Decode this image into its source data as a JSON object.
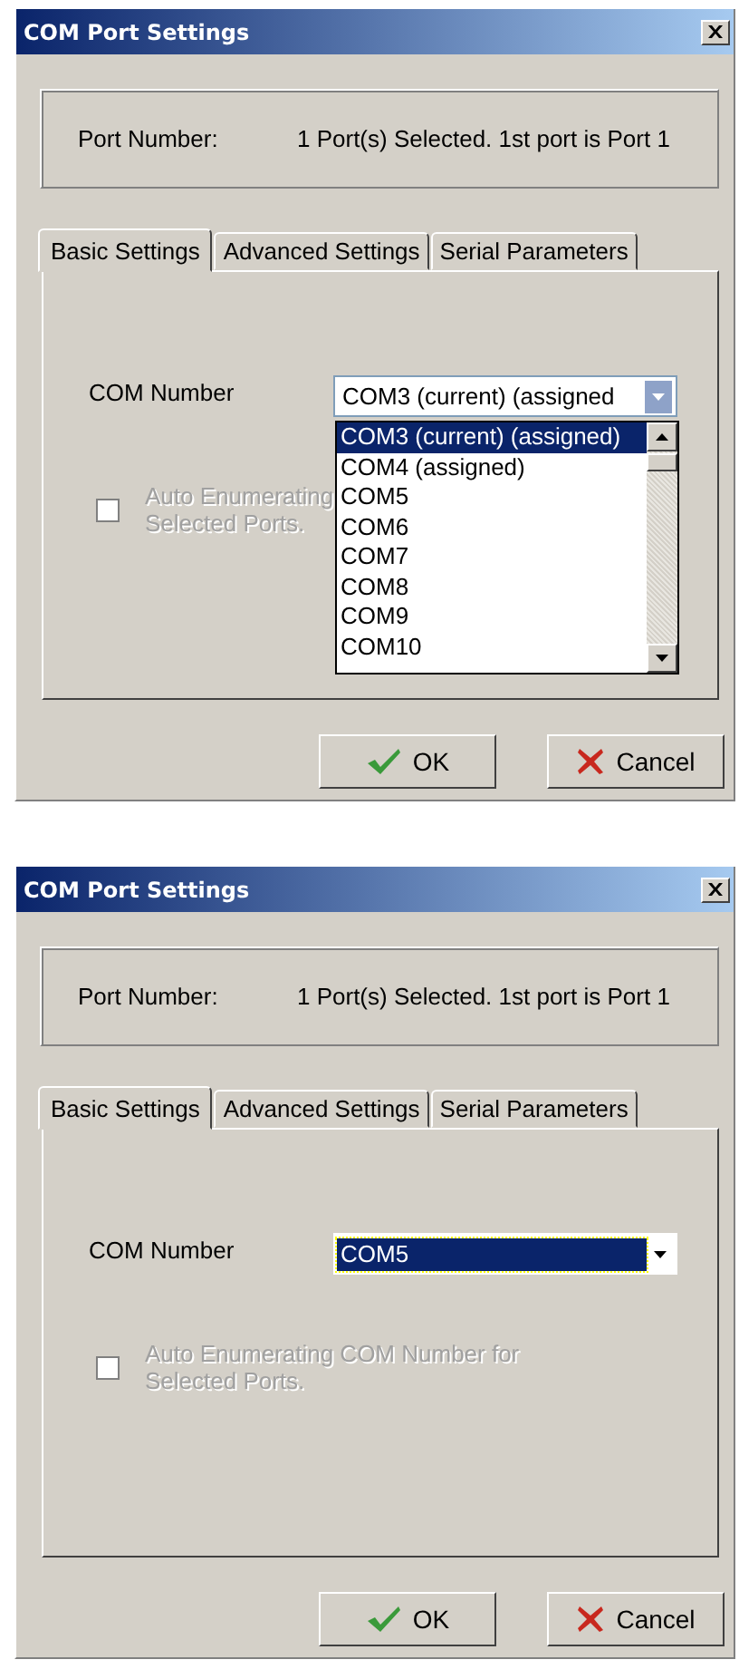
{
  "dialogs": [
    {
      "title": "COM Port Settings",
      "port_label": "Port Number:",
      "port_value": "1 Port(s) Selected. 1st port is Port 1",
      "tabs": [
        {
          "label": "Basic Settings",
          "selected": true
        },
        {
          "label": "Advanced Settings",
          "selected": false
        },
        {
          "label": "Serial Parameters",
          "selected": false
        }
      ],
      "com_label": "COM Number",
      "combo": {
        "value": "COM3 (current) (assigned",
        "open": true,
        "highlighted": false,
        "items": [
          {
            "label": "COM3 (current) (assigned)",
            "selected": true
          },
          {
            "label": "COM4 (assigned)",
            "selected": false
          },
          {
            "label": "COM5",
            "selected": false
          },
          {
            "label": "COM6",
            "selected": false
          },
          {
            "label": "COM7",
            "selected": false
          },
          {
            "label": "COM8",
            "selected": false
          },
          {
            "label": "COM9",
            "selected": false
          },
          {
            "label": "COM10",
            "selected": false
          }
        ]
      },
      "checkbox": {
        "lines": [
          "Auto Enumerating",
          "Selected Ports."
        ],
        "checked": false,
        "disabled": true
      },
      "buttons": [
        {
          "label": "OK",
          "kind": "ok"
        },
        {
          "label": "Cancel",
          "kind": "cancel"
        }
      ]
    },
    {
      "title": "COM Port Settings",
      "port_label": "Port Number:",
      "port_value": "1 Port(s) Selected. 1st port is Port 1",
      "tabs": [
        {
          "label": "Basic Settings",
          "selected": true
        },
        {
          "label": "Advanced Settings",
          "selected": false
        },
        {
          "label": "Serial Parameters",
          "selected": false
        }
      ],
      "com_label": "COM Number",
      "combo": {
        "value": "COM5",
        "open": false,
        "highlighted": true
      },
      "checkbox": {
        "lines": [
          "Auto Enumerating COM Number for",
          "Selected Ports."
        ],
        "checked": false,
        "disabled": true
      },
      "buttons": [
        {
          "label": "OK",
          "kind": "ok"
        },
        {
          "label": "Cancel",
          "kind": "cancel"
        }
      ]
    }
  ]
}
